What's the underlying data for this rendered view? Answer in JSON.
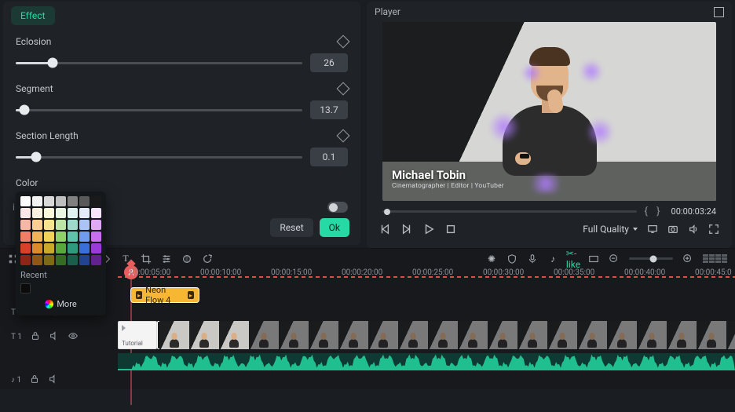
{
  "effect": {
    "tab_label": "Effect",
    "params": {
      "eclosion": {
        "label": "Eclosion",
        "value": "26",
        "percent": 13
      },
      "segment": {
        "label": "Segment",
        "value": "13.7",
        "percent": 3
      },
      "section_length": {
        "label": "Section Length",
        "value": "0.1",
        "percent": 7
      }
    },
    "color_label": "Color",
    "reset_label": "Reset",
    "ok_label": "Ok"
  },
  "colorpicker": {
    "recent_label": "Recent",
    "more_label": "More",
    "swatches": [
      "#ffffff",
      "#f2f2f2",
      "#d9d9d9",
      "#bfbfbf",
      "#808080",
      "#595959",
      "#1a1a1a",
      "#fde7e7",
      "#fdf0de",
      "#fdf8dc",
      "#e9f7e2",
      "#def3ef",
      "#e4ecfb",
      "#f5e4fb",
      "#f8b6a5",
      "#f9cf92",
      "#f9e38e",
      "#bde6a5",
      "#9edacc",
      "#a9c4f5",
      "#e0a9f5",
      "#f07f67",
      "#f3b35a",
      "#f3d25a",
      "#8fd26a",
      "#60c3ac",
      "#6f9cef",
      "#c86fef",
      "#d9402a",
      "#d98a2a",
      "#c9a82a",
      "#5aa83b",
      "#2e9a7e",
      "#3a6fd9",
      "#9a3ad9",
      "#8e2517",
      "#8e5617",
      "#7e6917",
      "#356b22",
      "#1a5f4c",
      "#224490",
      "#612290"
    ]
  },
  "player": {
    "title": "Player",
    "lower_third_name": "Michael Tobin",
    "lower_third_sub": "Cinematographer | Editor | YouTuber",
    "timecode": "00:00:03:24",
    "quality_label": "Full Quality"
  },
  "timeline": {
    "marks": [
      "00:00:05:00",
      "00:00:10:00",
      "00:00:15:00",
      "00:00:20:00",
      "00:00:25:00",
      "00:00:30:00",
      "00:00:35:00",
      "00:00:40:00",
      "00:00:45:0"
    ],
    "effect_clip": "Neon Flow 4",
    "tutorial_label": "Tutorial",
    "track_labels": {
      "fx": "T 1",
      "video": "T 1",
      "audio": "♪ 1"
    }
  }
}
